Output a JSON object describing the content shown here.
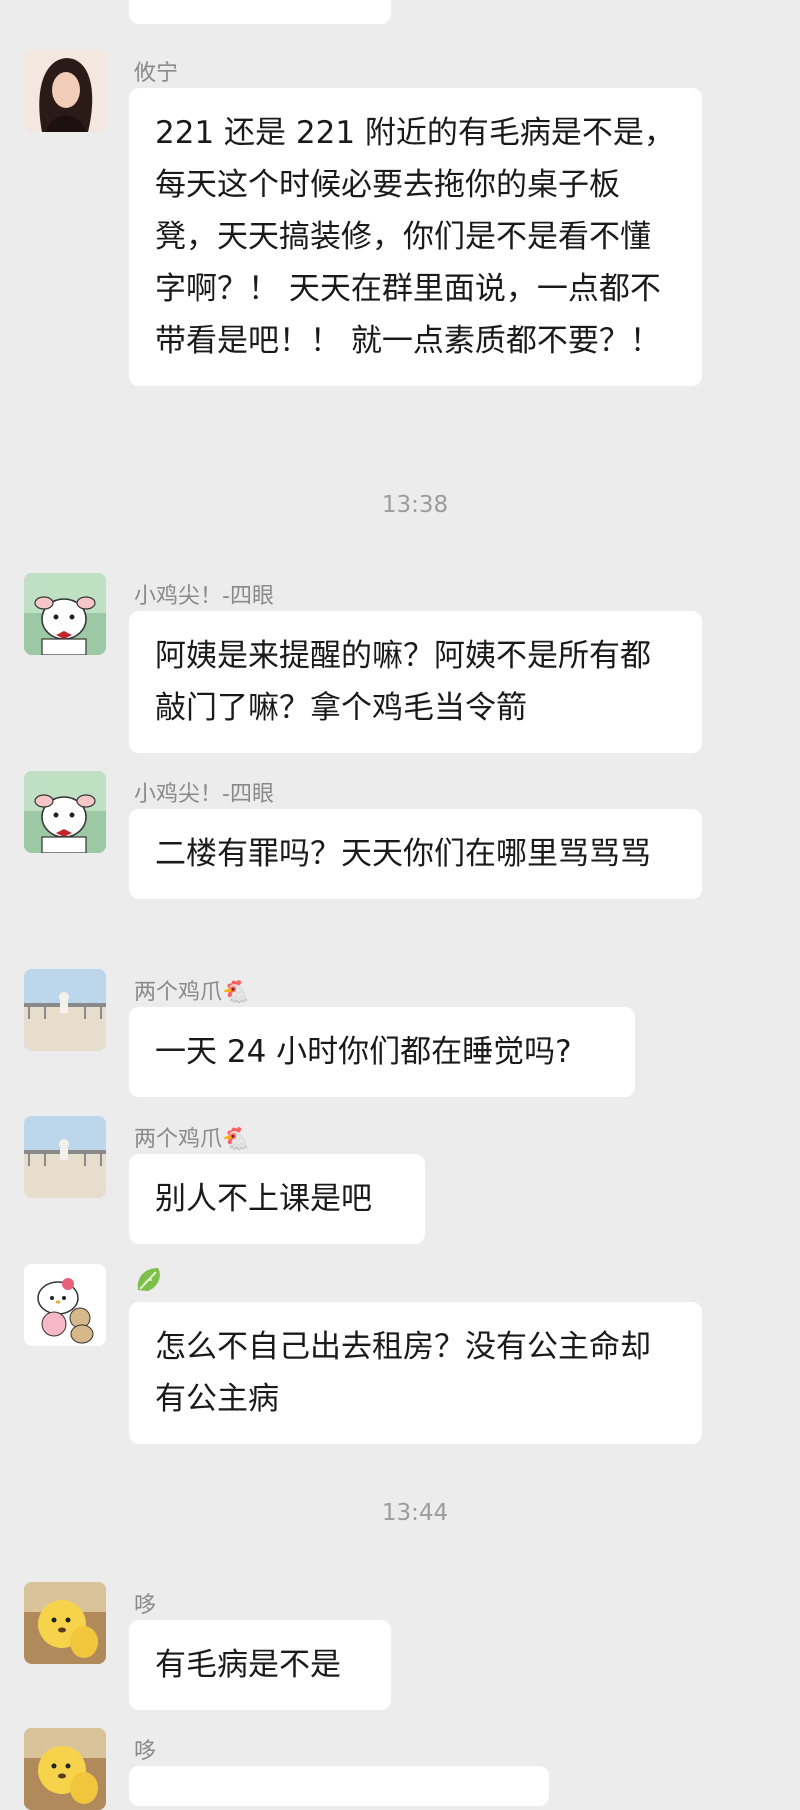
{
  "messages": [
    {
      "sender": "攸宁",
      "text": "221 还是 221 附近的有毛病是不是，每天这个时候必要去拖你的桌子板凳，天天搞装修，你们是不是看不懂字啊？！ 天天在群里面说，一点都不带看是吧！！ 就一点素质都不要？！"
    },
    {
      "sender": "小鸡尖！-四眼",
      "text": "阿姨是来提醒的嘛？阿姨不是所有都敲门了嘛？拿个鸡毛当令箭"
    },
    {
      "sender": "小鸡尖！-四眼",
      "text": "二楼有罪吗？天天你们在哪里骂骂骂"
    },
    {
      "sender": "两个鸡爪🐔",
      "text": "一天 24 小时你们都在睡觉吗?"
    },
    {
      "sender": "两个鸡爪🐔",
      "text": "别人不上课是吧"
    },
    {
      "sender": "🥬",
      "text": "怎么不自己出去租房？没有公主命却有公主病"
    },
    {
      "sender": "哆",
      "text": "有毛病是不是"
    },
    {
      "sender": "哆",
      "text": ""
    }
  ],
  "timestamps": [
    "13:38",
    "13:44"
  ],
  "colors": {
    "background": "#ececec",
    "bubble": "#ffffff",
    "sender": "#8a8a8a",
    "timestamp": "#9c9c9c"
  }
}
